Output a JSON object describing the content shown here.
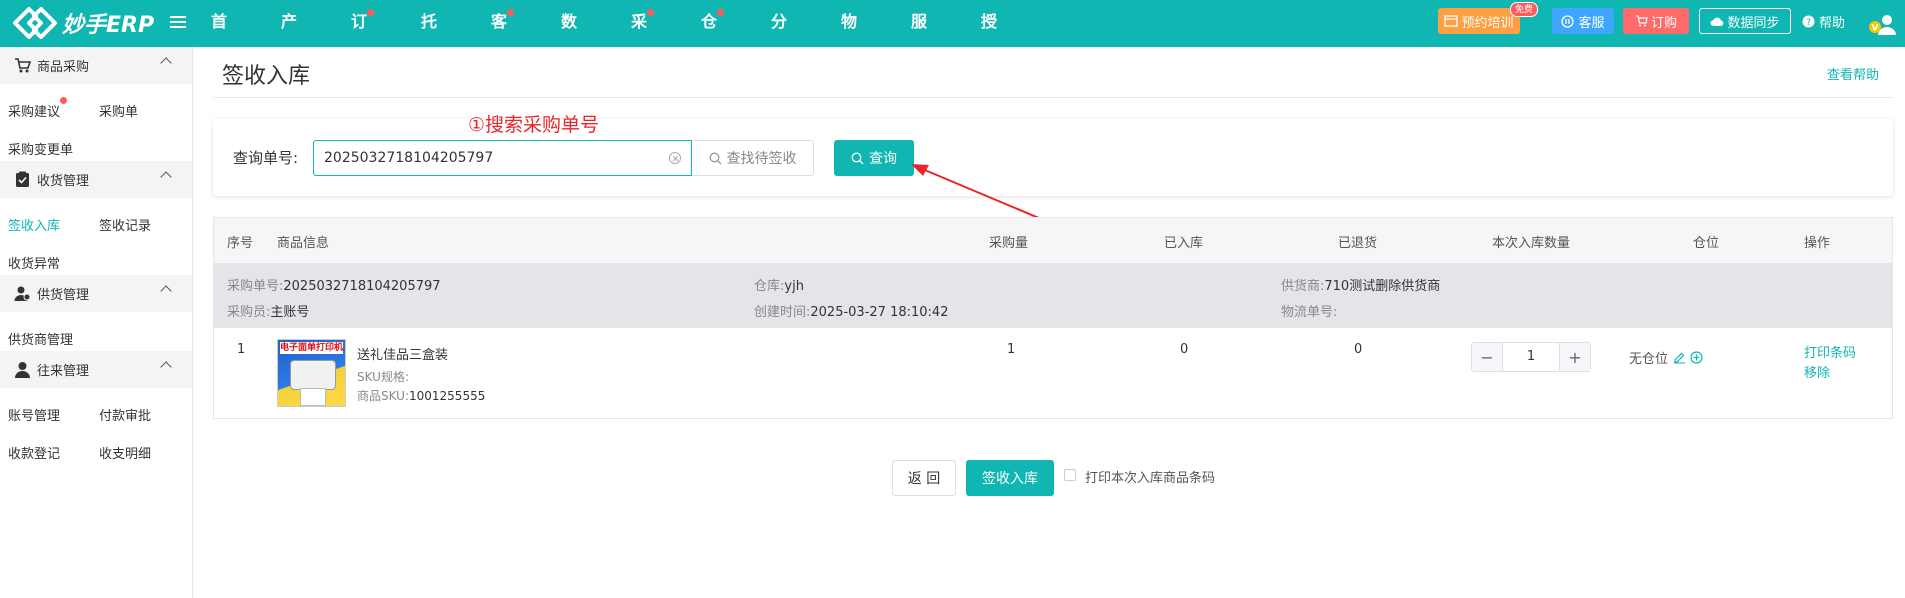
{
  "app": {
    "logo_text": "妙手ERP"
  },
  "nav": {
    "items": [
      {
        "label": "首页",
        "dot": false
      },
      {
        "label": "产品",
        "dot": false
      },
      {
        "label": "订单",
        "dot": true
      },
      {
        "label": "托管",
        "dot": false
      },
      {
        "label": "客服",
        "dot": true
      },
      {
        "label": "数据",
        "dot": false
      },
      {
        "label": "采购",
        "dot": true
      },
      {
        "label": "仓库",
        "dot": true
      },
      {
        "label": "分销",
        "dot": false
      },
      {
        "label": "物流",
        "dot": false
      },
      {
        "label": "服务",
        "dot": false
      },
      {
        "label": "授权",
        "dot": false
      }
    ]
  },
  "tools": {
    "training": "预约培训",
    "free_badge": "免费",
    "kefu": "客服",
    "order": "订购",
    "sync": "数据同步",
    "help": "帮助"
  },
  "sidebar": {
    "groups": [
      {
        "title": "商品采购",
        "icon": "cart-icon",
        "items": [
          [
            "采购建议",
            "采购单"
          ],
          [
            "采购变更单"
          ]
        ]
      },
      {
        "title": "收货管理",
        "icon": "clipboard-check-icon",
        "items": [
          [
            "签收入库",
            "签收记录"
          ],
          [
            "收货异常"
          ]
        ]
      },
      {
        "title": "供货管理",
        "icon": "supplier-icon",
        "items": [
          [
            "供货商管理"
          ]
        ]
      },
      {
        "title": "往来管理",
        "icon": "user-icon",
        "items": [
          [
            "账号管理",
            "付款审批"
          ],
          [
            "收款登记",
            "收支明细"
          ]
        ]
      }
    ],
    "active_item": "签收入库"
  },
  "page": {
    "title": "签收入库",
    "help_link": "查看帮助"
  },
  "search": {
    "label": "查询单号:",
    "value": "2025032718104205797",
    "find_pending": "查找待签收",
    "query_btn": "查询",
    "annotation": "①搜索采购单号"
  },
  "table": {
    "headers": {
      "index": "序号",
      "product": "商品信息",
      "purchase_qty": "采购量",
      "received": "已入库",
      "returned": "已退货",
      "this_qty": "本次入库数量",
      "location": "仓位",
      "action": "操作"
    },
    "group": {
      "po_label": "采购单号:",
      "po_value": "2025032718104205797",
      "warehouse_label": "仓库:",
      "warehouse_value": "yjh",
      "supplier_label": "供货商:",
      "supplier_value": "710测试删除供货商",
      "buyer_label": "采购员:",
      "buyer_value": "主账号",
      "created_label": "创建时间:",
      "created_value": "2025-03-27 18:10:42",
      "tracking_label": "物流单号:",
      "tracking_value": ""
    },
    "row": {
      "index": "1",
      "thumb_text": "电子面单打印机",
      "name": "送礼佳品三盒装",
      "sku_spec_label": "SKU规格:",
      "sku_spec_value": "",
      "sku_label": "商品SKU:",
      "sku_value": "1001255555",
      "purchase_qty": "1",
      "received": "0",
      "returned": "0",
      "this_qty": "1",
      "location": "无仓位",
      "print_barcode": "打印条码",
      "remove": "移除"
    }
  },
  "footer": {
    "return_btn": "返 回",
    "sign_btn": "签收入库",
    "print_checkbox_label": "打印本次入库商品条码"
  },
  "colors": {
    "primary": "#0fb6b2",
    "annotation": "#e8262a",
    "training_btn": "#ff9f43",
    "order_btn": "#ff6b6b",
    "kefu_btn": "#3ea6ff",
    "dot": "#ff5a5a"
  }
}
